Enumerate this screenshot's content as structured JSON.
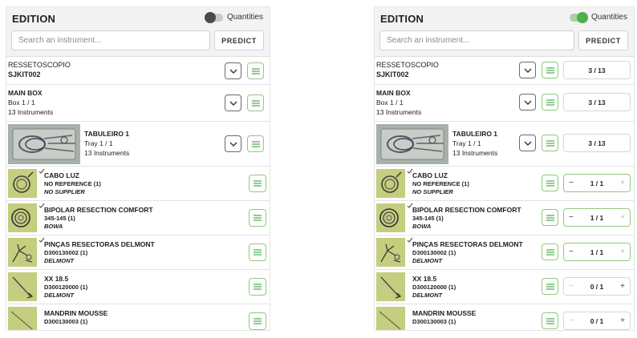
{
  "left": {
    "title": "EDITION",
    "quantities_label": "Quantities",
    "quantities_on": false,
    "search": {
      "placeholder": "Search an instrument...",
      "value": ""
    },
    "predict_label": "PREDICT",
    "kit": {
      "name": "RESSETOSCOPIO",
      "code": "SJKIT002"
    },
    "box": {
      "name": "MAIN BOX",
      "position": "Box 1 / 1",
      "count": "13 Instruments"
    },
    "tray": {
      "name": "TABULEIRO 1",
      "position": "Tray 1 / 1",
      "count": "13 Instruments"
    },
    "instruments": [
      {
        "name": "CABO LUZ",
        "reference": "NO REFERENCE (1)",
        "supplier": "NO SUPPLIER",
        "checked": true
      },
      {
        "name": "BIPOLAR RESECTION COMFORT",
        "reference": "345-145 (1)",
        "supplier": "BOWA",
        "checked": true
      },
      {
        "name": "PINÇAS RESECTORAS DELMONT",
        "reference": "D300130002 (1)",
        "supplier": "DELMONT",
        "checked": true
      },
      {
        "name": "XX 18.5",
        "reference": "D300120000 (1)",
        "supplier": "DELMONT",
        "checked": false
      },
      {
        "name": "MANDRIN MOUSSE",
        "reference": "D300130003 (1)",
        "supplier": "",
        "checked": false
      }
    ]
  },
  "right": {
    "title": "EDITION",
    "quantities_label": "Quantities",
    "quantities_on": true,
    "search": {
      "placeholder": "Search an instrument...",
      "value": ""
    },
    "predict_label": "PREDICT",
    "kit": {
      "name": "RESSETOSCOPIO",
      "code": "SJKIT002",
      "counter": "3 / 13"
    },
    "box": {
      "name": "MAIN BOX",
      "position": "Box 1 / 1",
      "count": "13 Instruments",
      "counter": "3 / 13"
    },
    "tray": {
      "name": "TABULEIRO 1",
      "position": "Tray 1 / 1",
      "count": "13 Instruments",
      "counter": "3 / 13"
    },
    "instruments": [
      {
        "name": "CABO LUZ",
        "reference": "NO REFERENCE (1)",
        "supplier": "NO SUPPLIER",
        "quantity": "1 / 1",
        "checked": true
      },
      {
        "name": "BIPOLAR RESECTION COMFORT",
        "reference": "345-145 (1)",
        "supplier": "BOWA",
        "quantity": "1 / 1",
        "checked": true
      },
      {
        "name": "PINÇAS RESECTORAS DELMONT",
        "reference": "D300130002 (1)",
        "supplier": "DELMONT",
        "quantity": "1 / 1",
        "checked": true
      },
      {
        "name": "XX 18.5",
        "reference": "D300120000 (1)",
        "supplier": "DELMONT",
        "quantity": "0 / 1",
        "checked": false
      },
      {
        "name": "MANDRIN MOUSSE",
        "reference": "D300130003 (1)",
        "supplier": "",
        "quantity": "0 / 1",
        "checked": false
      }
    ],
    "stepper_minus": "−",
    "stepper_plus": "+"
  },
  "colors": {
    "accent_green": "#4caf50",
    "button_green_border": "#8fc97c",
    "header_bg": "#f3f3f3",
    "instrument_thumb_bg": "#c5cd7e"
  },
  "icons": {
    "chevron": "chevron-down-icon",
    "list": "list-icon",
    "check": "check-icon"
  }
}
